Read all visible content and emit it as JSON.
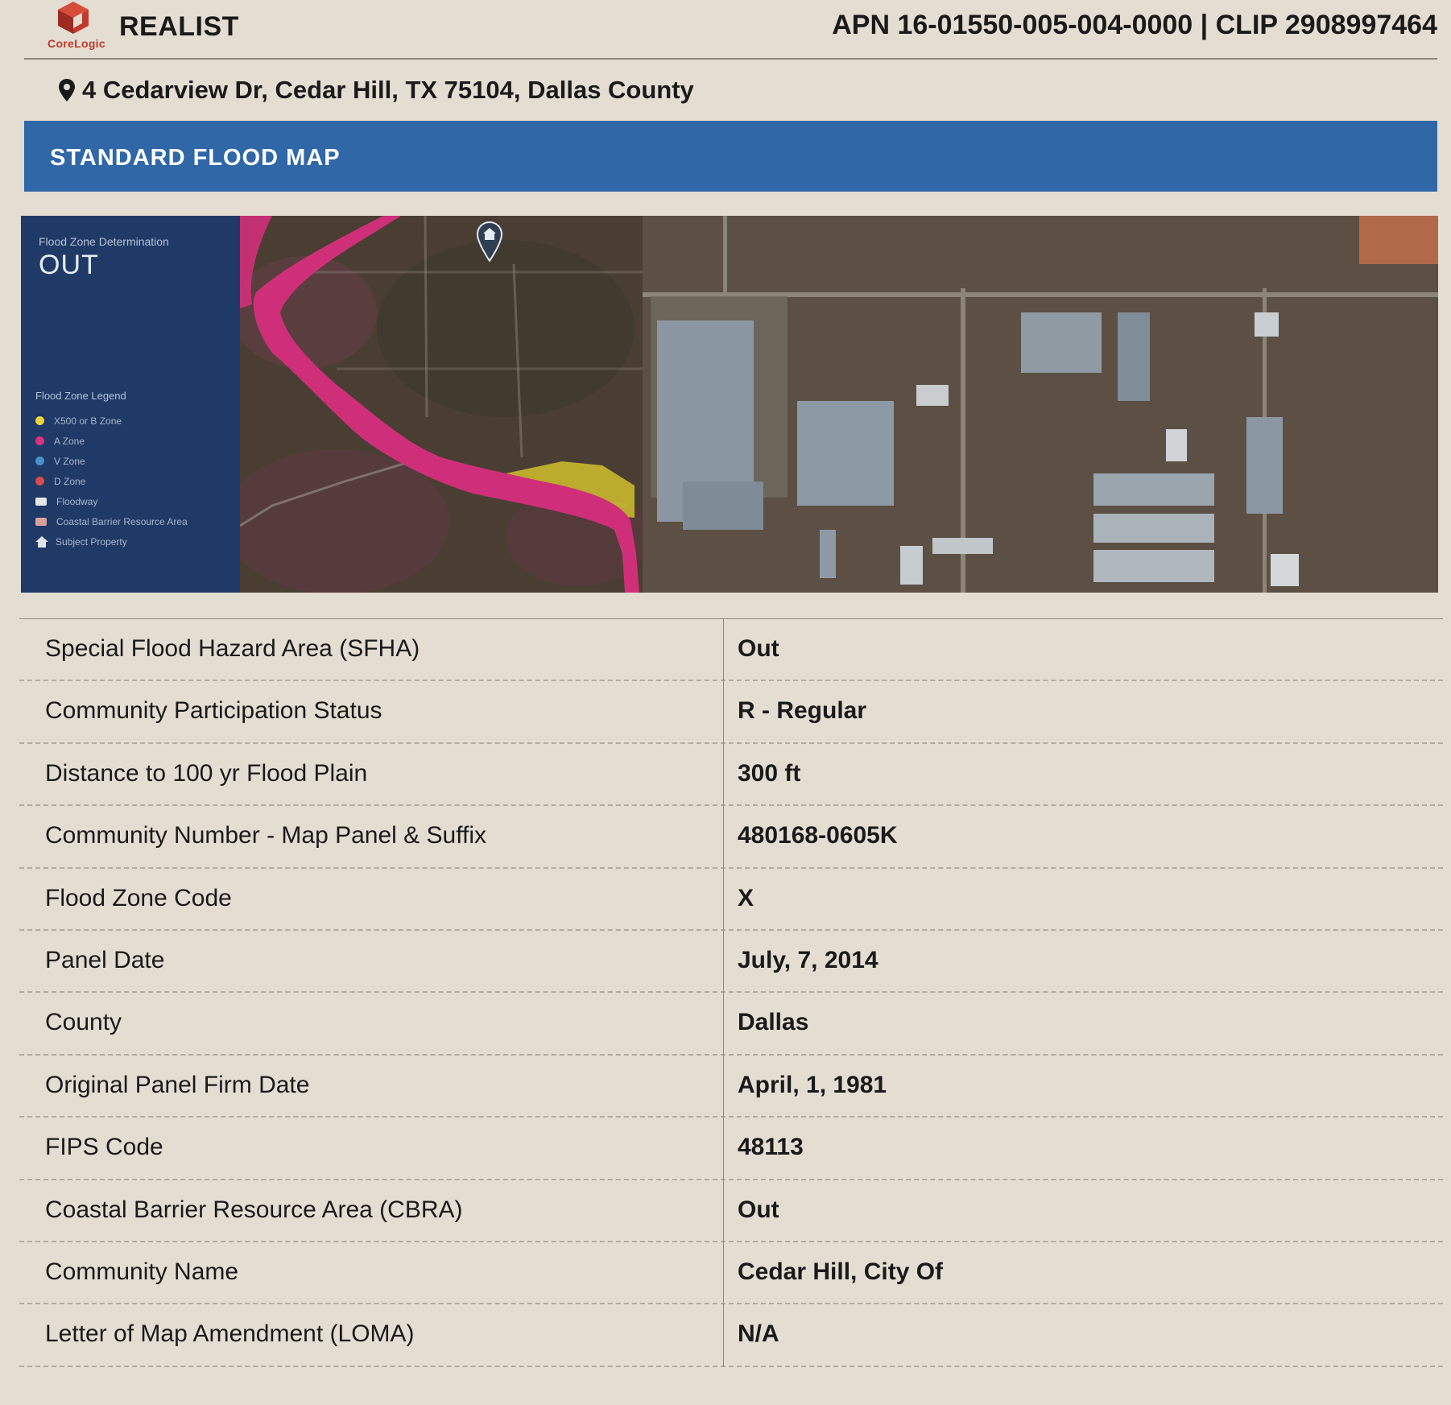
{
  "header": {
    "brand": "CoreLogic",
    "product": "REALIST",
    "ids": "APN 16-01550-005-004-0000 | CLIP 2908997464"
  },
  "address": "4 Cedarview Dr, Cedar Hill, TX 75104, Dallas County",
  "section_title": "STANDARD FLOOD MAP",
  "map": {
    "determination_label": "Flood Zone Determination",
    "determination_value": "OUT",
    "legend_title": "Flood Zone Legend",
    "legend": [
      {
        "label": "X500 or B Zone",
        "color": "#e8d43a"
      },
      {
        "label": "A Zone",
        "color": "#d9337c"
      },
      {
        "label": "V Zone",
        "color": "#4a8fc9"
      },
      {
        "label": "D Zone",
        "color": "#d94a4a"
      },
      {
        "label": "Floodway",
        "color": "#e6e6e6"
      },
      {
        "label": "Coastal Barrier Resource Area",
        "color": "#d9a0a0"
      },
      {
        "label": "Subject Property",
        "color": "#e6e6e6"
      }
    ]
  },
  "rows": [
    {
      "label": "Special Flood Hazard Area (SFHA)",
      "value": "Out"
    },
    {
      "label": "Community Participation Status",
      "value": "R - Regular"
    },
    {
      "label": "Distance to 100 yr Flood Plain",
      "value": "300 ft"
    },
    {
      "label": "Community Number - Map Panel & Suffix",
      "value": "480168-0605K"
    },
    {
      "label": "Flood Zone Code",
      "value": "X"
    },
    {
      "label": "Panel Date",
      "value": "July, 7, 2014"
    },
    {
      "label": "County",
      "value": "Dallas"
    },
    {
      "label": "Original Panel Firm Date",
      "value": "April, 1, 1981"
    },
    {
      "label": "FIPS Code",
      "value": "48113"
    },
    {
      "label": "Coastal Barrier Resource Area (CBRA)",
      "value": "Out"
    },
    {
      "label": "Community Name",
      "value": "Cedar Hill, City Of"
    },
    {
      "label": "Letter of Map Amendment (LOMA)",
      "value": "N/A"
    }
  ]
}
